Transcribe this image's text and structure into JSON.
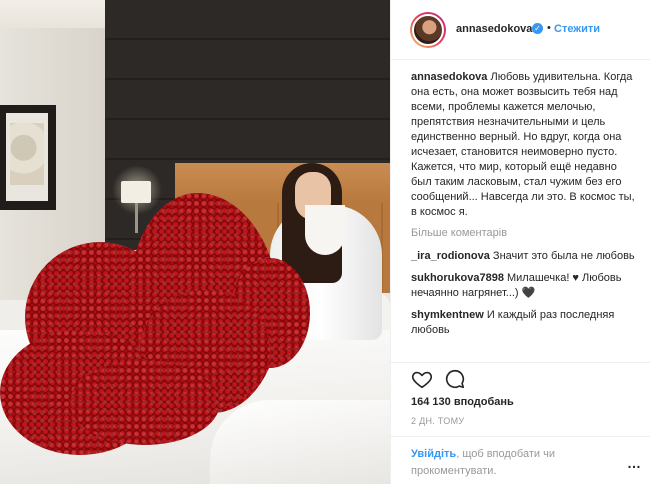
{
  "post": {
    "username": "annasedokova",
    "verified": true,
    "separator": "•",
    "follow_label": "Стежити",
    "caption": "Любовь удивительна. Когда она есть, она может возвысить тебя над всеми, проблемы кажется мелочью, препятствия незначительными и цель единственно верный. Но вдруг, когда она исчезает, становится неимоверно пусто. Кажется, что мир, который ещё недавно был таким ласковым, стал чужим без его сообщений... Навсегда ли это. В космос ты, в космос я.",
    "more_comments": "Більше коментарів",
    "comments": [
      {
        "user": "_ira_rodionova",
        "text": "Значит это была не любовь"
      },
      {
        "user": "sukhorukova7898",
        "text": "Милашечка! ♥ Любовь нечаянно нагрянет...) 🖤"
      },
      {
        "user": "shymkentnew",
        "text": "И каждый раз последняя любовь"
      }
    ],
    "likes": "164 130 вподобань",
    "time": "2 ДН. ТОМУ",
    "login_link": "Увійдіть",
    "login_text": ", щоб вподобати чи прокоментувати.",
    "menu_icon": "…"
  },
  "icons": {
    "like": "heart-icon",
    "comment": "comment-icon",
    "more": "more-options-icon"
  },
  "colors": {
    "accent": "#3897f0",
    "muted": "#999999",
    "text": "#262626",
    "roses": "#8f0a0e"
  }
}
